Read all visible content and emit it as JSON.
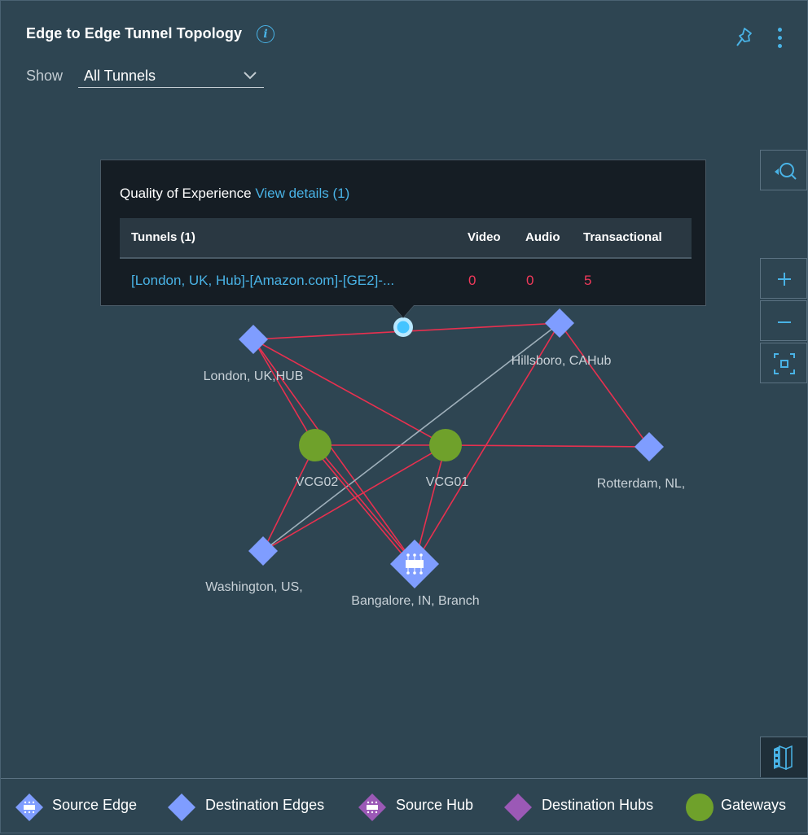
{
  "header": {
    "title": "Edge to Edge Tunnel Topology",
    "info_icon": "info-icon",
    "pin_icon": "pin-icon",
    "more_icon": "kebab-menu-icon"
  },
  "filter": {
    "label": "Show",
    "selected": "All Tunnels"
  },
  "popover": {
    "title": "Quality of Experience",
    "link": "View details (1)",
    "columns": [
      "Tunnels (1)",
      "Video",
      "Audio",
      "Transactional"
    ],
    "rows": [
      {
        "tunnel": "[London, UK, Hub]-[Amazon.com]-[GE2]-...",
        "video": "0",
        "audio": "0",
        "transactional": "5"
      }
    ]
  },
  "graph": {
    "colors": {
      "edge": "#7f9dff",
      "hub": "#9b59b6",
      "gateway": "#6fa12b",
      "tunnel_red": "#e8304f",
      "tunnel_gray": "#9fb0bb",
      "selected_dot": "#45c4ff"
    },
    "nodes": [
      {
        "id": "london",
        "label": "London, UK,HUB",
        "type": "destination-edge"
      },
      {
        "id": "hillsboro",
        "label": "Hillsboro, CAHub",
        "type": "destination-edge"
      },
      {
        "id": "vcg02",
        "label": "VCG02",
        "type": "gateway"
      },
      {
        "id": "vcg01",
        "label": "VCG01",
        "type": "gateway"
      },
      {
        "id": "rotterdam",
        "label": "Rotterdam, NL,",
        "type": "destination-edge"
      },
      {
        "id": "washington",
        "label": "Washington, US,",
        "type": "destination-edge"
      },
      {
        "id": "bangalore",
        "label": "Bangalore, IN, Branch",
        "type": "source-edge"
      }
    ],
    "links": [
      {
        "from": "london",
        "to": "hillsboro",
        "status": "red",
        "selected": true
      },
      {
        "from": "london",
        "to": "vcg02",
        "status": "red"
      },
      {
        "from": "london",
        "to": "bangalore",
        "status": "red"
      },
      {
        "from": "london",
        "to": "vcg01",
        "status": "red"
      },
      {
        "from": "hillsboro",
        "to": "washington",
        "status": "gray"
      },
      {
        "from": "hillsboro",
        "to": "bangalore",
        "status": "red"
      },
      {
        "from": "hillsboro",
        "to": "rotterdam",
        "status": "red"
      },
      {
        "from": "vcg02",
        "to": "vcg01",
        "status": "red"
      },
      {
        "from": "vcg01",
        "to": "rotterdam",
        "status": "red"
      },
      {
        "from": "vcg02",
        "to": "washington",
        "status": "red"
      },
      {
        "from": "vcg02",
        "to": "bangalore",
        "status": "red"
      },
      {
        "from": "vcg02",
        "to": "bangalore",
        "status": "red"
      },
      {
        "from": "vcg01",
        "to": "washington",
        "status": "red"
      },
      {
        "from": "vcg01",
        "to": "bangalore",
        "status": "red"
      }
    ]
  },
  "toolbar": {
    "search_icon": "search-locate-icon",
    "zoom_in_icon": "plus-icon",
    "zoom_out_icon": "minus-icon",
    "fit_icon": "fit-to-screen-icon",
    "map_icon": "map-icon"
  },
  "legend": [
    {
      "label": "Source Edge",
      "shape": "diamond-icon",
      "color": "#7f9dff"
    },
    {
      "label": "Destination Edges",
      "shape": "diamond",
      "color": "#7f9dff"
    },
    {
      "label": "Source Hub",
      "shape": "diamond-icon",
      "color": "#9b59b6"
    },
    {
      "label": "Destination Hubs",
      "shape": "diamond",
      "color": "#9b59b6"
    },
    {
      "label": "Gateways",
      "shape": "circle",
      "color": "#6fa12b"
    }
  ]
}
